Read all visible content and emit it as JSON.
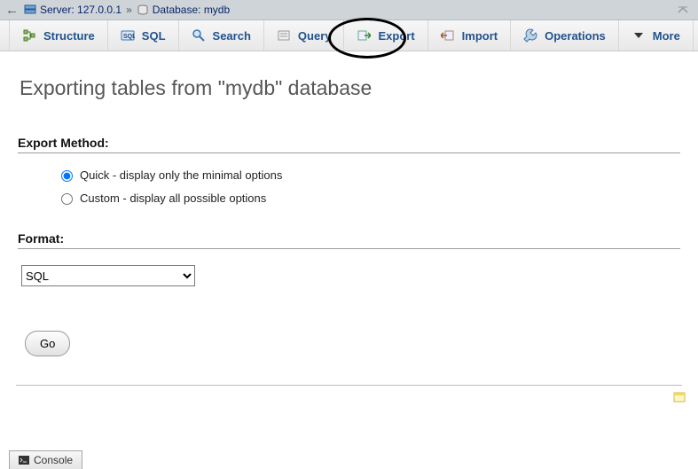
{
  "breadcrumb": {
    "server_label": "Server:",
    "server_value": "127.0.0.1",
    "database_label": "Database:",
    "database_value": "mydb"
  },
  "tabs": {
    "structure": "Structure",
    "sql": "SQL",
    "search": "Search",
    "query": "Query",
    "export": "Export",
    "import": "Import",
    "operations": "Operations",
    "more": "More"
  },
  "page": {
    "title": "Exporting tables from \"mydb\" database"
  },
  "export_method": {
    "heading": "Export Method:",
    "quick": "Quick - display only the minimal options",
    "custom": "Custom - display all possible options",
    "selected": "quick"
  },
  "format": {
    "heading": "Format:",
    "selected": "SQL"
  },
  "go_label": "Go",
  "console_label": "Console"
}
